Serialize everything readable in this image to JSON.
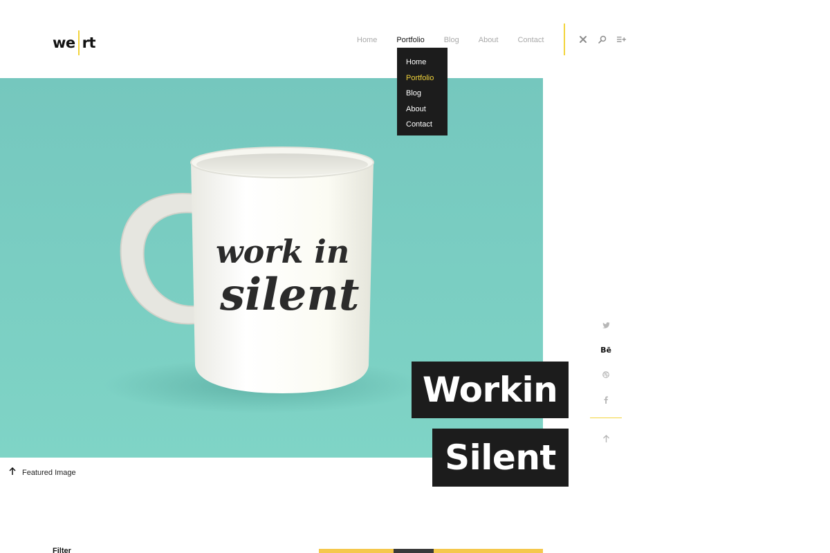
{
  "logo": {
    "text_left": "we",
    "text_right": "rt"
  },
  "nav": {
    "items": [
      {
        "label": "Home"
      },
      {
        "label": "Portfolio"
      },
      {
        "label": "Blog"
      },
      {
        "label": "About"
      },
      {
        "label": "Contact"
      }
    ],
    "tools": [
      "close-icon",
      "search-icon",
      "menu-add-icon"
    ]
  },
  "dropdown": {
    "items": [
      {
        "label": "Home"
      },
      {
        "label": "Portfolio"
      },
      {
        "label": "Blog"
      },
      {
        "label": "About"
      },
      {
        "label": "Contact"
      }
    ]
  },
  "hero": {
    "title_line1": "Workin",
    "title_line2": "Silent",
    "mug_text_line1": "work in",
    "mug_text_line2": "silent",
    "background_color": "#7fd0c3"
  },
  "featured": {
    "label": "Featured Image"
  },
  "social": {
    "behance_label": "Bē"
  },
  "bottom": {
    "filter_label": "Filter"
  },
  "colors": {
    "accent": "#f2d43b",
    "dark": "#1c1c1c"
  }
}
